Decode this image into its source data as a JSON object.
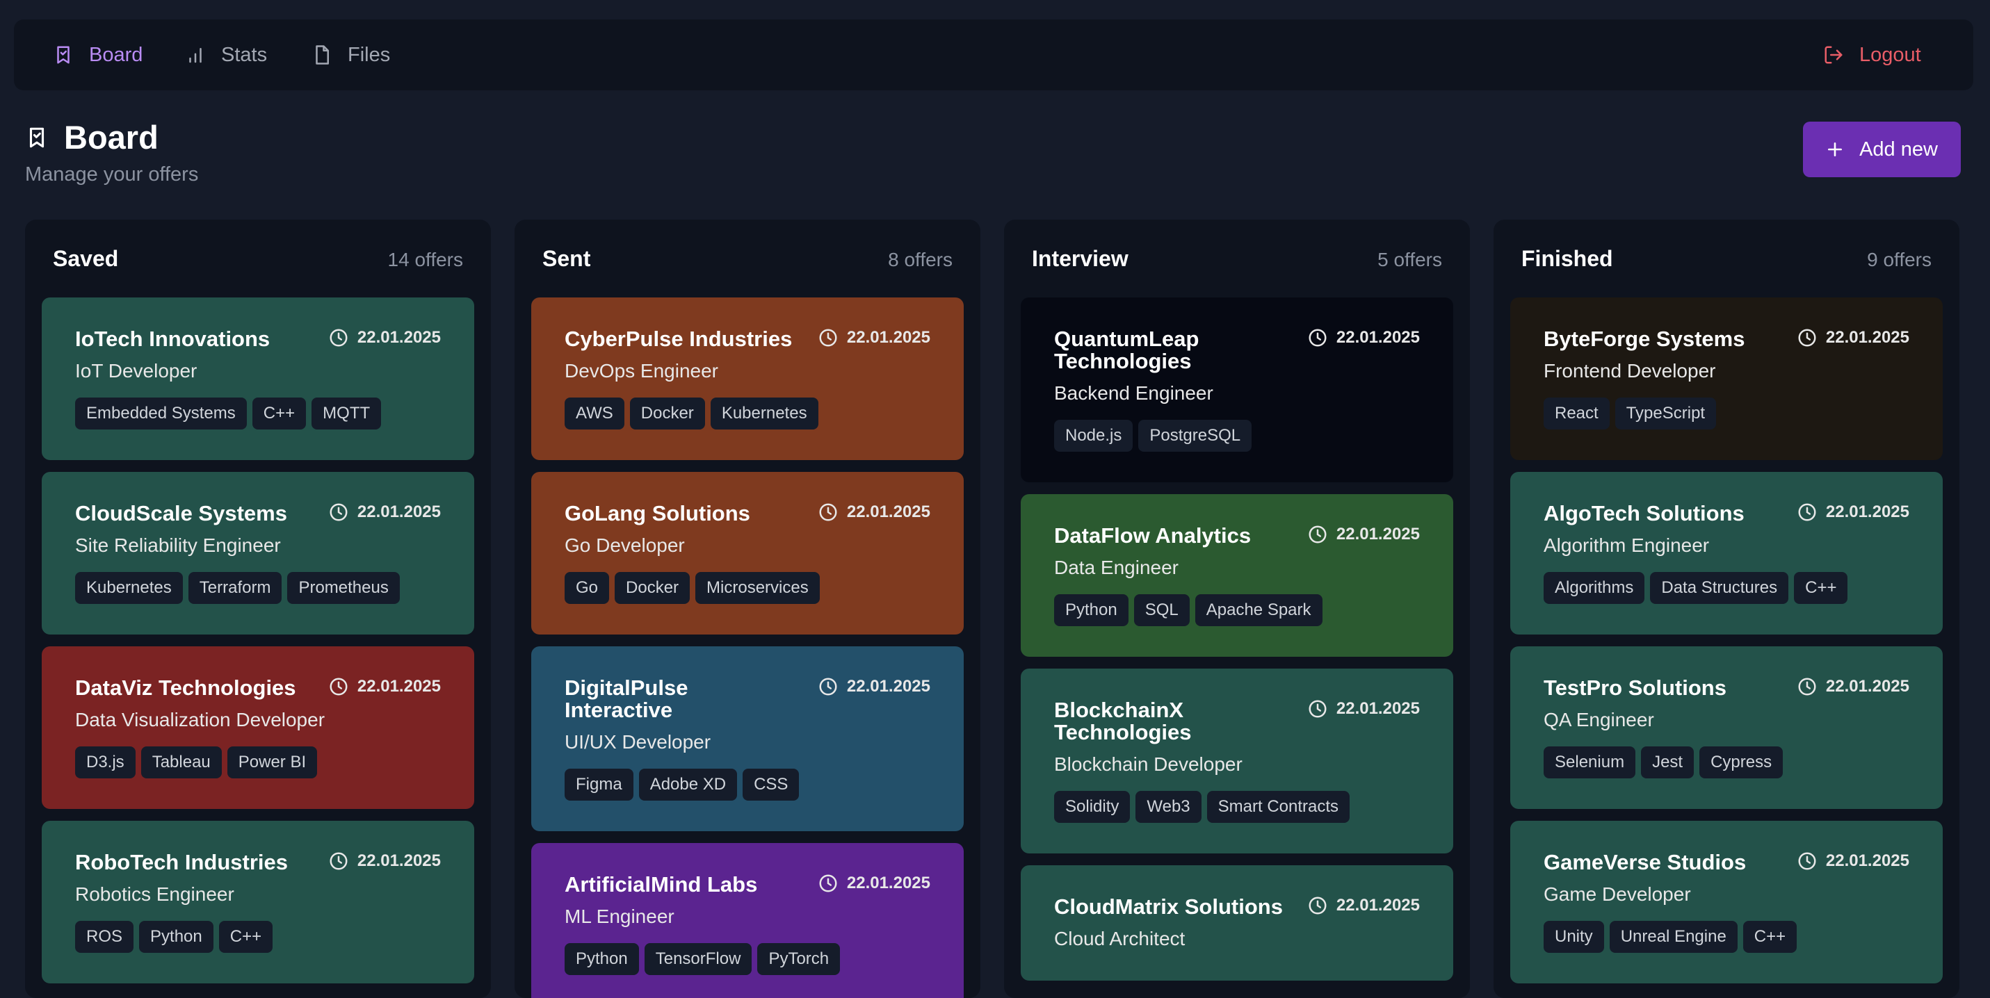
{
  "nav": {
    "items": [
      {
        "label": "Board",
        "icon": "bookmark-icon"
      },
      {
        "label": "Stats",
        "icon": "bar-chart-icon"
      },
      {
        "label": "Files",
        "icon": "file-icon"
      }
    ],
    "logout_label": "Logout"
  },
  "page": {
    "title": "Board",
    "subtitle": "Manage your offers",
    "add_label": "Add new"
  },
  "colors": {
    "accent": "#6b2fb2",
    "active_nav": "#b98cf3",
    "logout": "#e85d67",
    "card_teal": "#23524a",
    "card_red": "#7b2323",
    "card_orange": "#7f3a1f",
    "card_blue": "#23506a",
    "card_purple": "#5b2490",
    "card_black": "#060913",
    "card_green": "#2b5a30",
    "card_brown": "#1d1812"
  },
  "columns": [
    {
      "title": "Saved",
      "count": "14 offers",
      "cards": [
        {
          "company": "IoTech Innovations",
          "date": "22.01.2025",
          "role": "IoT Developer",
          "tags": [
            "Embedded Systems",
            "C++",
            "MQTT"
          ],
          "color": "#23524a"
        },
        {
          "company": "CloudScale Systems",
          "date": "22.01.2025",
          "role": "Site Reliability Engineer",
          "tags": [
            "Kubernetes",
            "Terraform",
            "Prometheus"
          ],
          "color": "#23524a"
        },
        {
          "company": "DataViz Technologies",
          "date": "22.01.2025",
          "role": "Data Visualization Developer",
          "tags": [
            "D3.js",
            "Tableau",
            "Power BI"
          ],
          "color": "#7b2323"
        },
        {
          "company": "RoboTech Industries",
          "date": "22.01.2025",
          "role": "Robotics Engineer",
          "tags": [
            "ROS",
            "Python",
            "C++"
          ],
          "color": "#23524a"
        }
      ]
    },
    {
      "title": "Sent",
      "count": "8 offers",
      "cards": [
        {
          "company": "CyberPulse Industries",
          "date": "22.01.2025",
          "role": "DevOps Engineer",
          "tags": [
            "AWS",
            "Docker",
            "Kubernetes"
          ],
          "color": "#7f3a1f"
        },
        {
          "company": "GoLang Solutions",
          "date": "22.01.2025",
          "role": "Go Developer",
          "tags": [
            "Go",
            "Docker",
            "Microservices"
          ],
          "color": "#7f3a1f"
        },
        {
          "company": "DigitalPulse Interactive",
          "date": "22.01.2025",
          "role": "UI/UX Developer",
          "tags": [
            "Figma",
            "Adobe XD",
            "CSS"
          ],
          "color": "#23506a"
        },
        {
          "company": "ArtificialMind Labs",
          "date": "22.01.2025",
          "role": "ML Engineer",
          "tags": [
            "Python",
            "TensorFlow",
            "PyTorch"
          ],
          "color": "#5b2490"
        }
      ]
    },
    {
      "title": "Interview",
      "count": "5 offers",
      "cards": [
        {
          "company": "QuantumLeap Technologies",
          "date": "22.01.2025",
          "role": "Backend Engineer",
          "tags": [
            "Node.js",
            "PostgreSQL"
          ],
          "color": "#060913"
        },
        {
          "company": "DataFlow Analytics",
          "date": "22.01.2025",
          "role": "Data Engineer",
          "tags": [
            "Python",
            "SQL",
            "Apache Spark"
          ],
          "color": "#2b5a30"
        },
        {
          "company": "BlockchainX Technologies",
          "date": "22.01.2025",
          "role": "Blockchain Developer",
          "tags": [
            "Solidity",
            "Web3",
            "Smart Contracts"
          ],
          "color": "#23524a"
        },
        {
          "company": "CloudMatrix Solutions",
          "date": "22.01.2025",
          "role": "Cloud Architect",
          "tags": [],
          "color": "#23524a"
        }
      ]
    },
    {
      "title": "Finished",
      "count": "9 offers",
      "cards": [
        {
          "company": "ByteForge Systems",
          "date": "22.01.2025",
          "role": "Frontend Developer",
          "tags": [
            "React",
            "TypeScript"
          ],
          "color": "#1d1812"
        },
        {
          "company": "AlgoTech Solutions",
          "date": "22.01.2025",
          "role": "Algorithm Engineer",
          "tags": [
            "Algorithms",
            "Data Structures",
            "C++"
          ],
          "color": "#23524a"
        },
        {
          "company": "TestPro Solutions",
          "date": "22.01.2025",
          "role": "QA Engineer",
          "tags": [
            "Selenium",
            "Jest",
            "Cypress"
          ],
          "color": "#23524a"
        },
        {
          "company": "GameVerse Studios",
          "date": "22.01.2025",
          "role": "Game Developer",
          "tags": [
            "Unity",
            "Unreal Engine",
            "C++"
          ],
          "color": "#23524a"
        }
      ]
    }
  ]
}
